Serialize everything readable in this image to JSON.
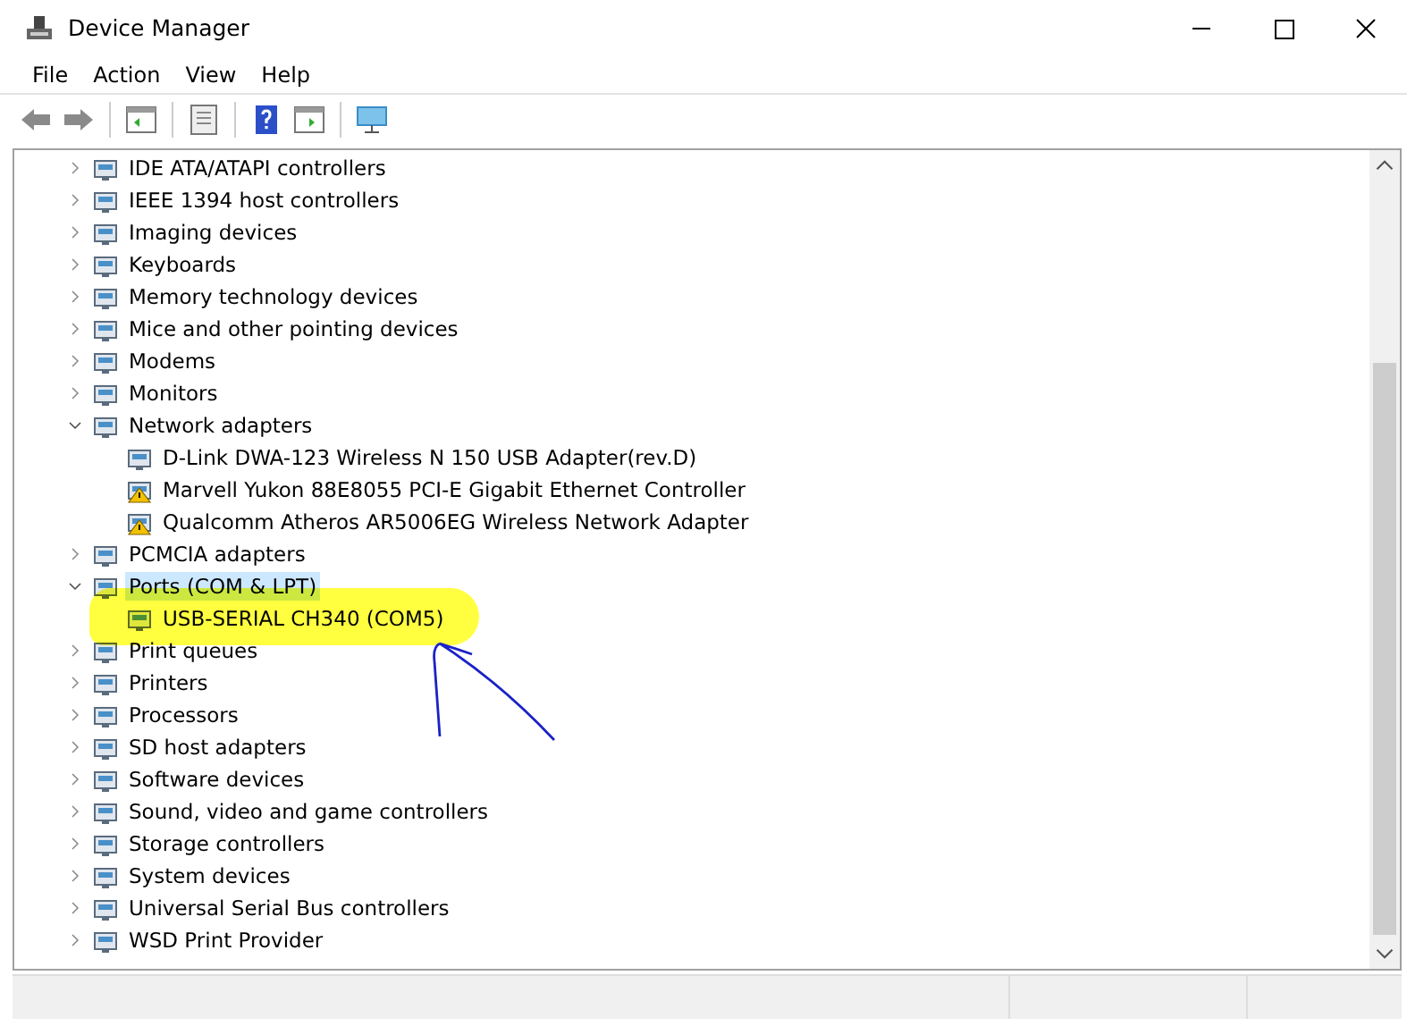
{
  "window": {
    "title": "Device Manager"
  },
  "menu": [
    "File",
    "Action",
    "View",
    "Help"
  ],
  "tree": [
    {
      "label": "IDE ATA/ATAPI controllers",
      "expanded": false,
      "selected": false
    },
    {
      "label": "IEEE 1394 host controllers",
      "expanded": false,
      "selected": false
    },
    {
      "label": "Imaging devices",
      "expanded": false,
      "selected": false
    },
    {
      "label": "Keyboards",
      "expanded": false,
      "selected": false
    },
    {
      "label": "Memory technology devices",
      "expanded": false,
      "selected": false
    },
    {
      "label": "Mice and other pointing devices",
      "expanded": false,
      "selected": false
    },
    {
      "label": "Modems",
      "expanded": false,
      "selected": false
    },
    {
      "label": "Monitors",
      "expanded": false,
      "selected": false
    },
    {
      "label": "Network adapters",
      "expanded": true,
      "selected": false,
      "children": [
        {
          "label": "D-Link DWA-123 Wireless N 150 USB Adapter(rev.D)",
          "warning": false,
          "selected": false
        },
        {
          "label": "Marvell Yukon 88E8055 PCI-E Gigabit Ethernet Controller",
          "warning": true,
          "selected": false
        },
        {
          "label": "Qualcomm Atheros AR5006EG Wireless Network Adapter",
          "warning": true,
          "selected": false
        }
      ]
    },
    {
      "label": "PCMCIA adapters",
      "expanded": false,
      "selected": false
    },
    {
      "label": "Ports (COM & LPT)",
      "expanded": true,
      "selected": true,
      "children": [
        {
          "label": "USB-SERIAL CH340 (COM5)",
          "warning": false,
          "selected": false
        }
      ]
    },
    {
      "label": "Print queues",
      "expanded": false,
      "selected": false
    },
    {
      "label": "Printers",
      "expanded": false,
      "selected": false
    },
    {
      "label": "Processors",
      "expanded": false,
      "selected": false
    },
    {
      "label": "SD host adapters",
      "expanded": false,
      "selected": false
    },
    {
      "label": "Software devices",
      "expanded": false,
      "selected": false
    },
    {
      "label": "Sound, video and game controllers",
      "expanded": false,
      "selected": false
    },
    {
      "label": "Storage controllers",
      "expanded": false,
      "selected": false
    },
    {
      "label": "System devices",
      "expanded": false,
      "selected": false
    },
    {
      "label": "Universal Serial Bus controllers",
      "expanded": false,
      "selected": false
    },
    {
      "label": "WSD Print Provider",
      "expanded": false,
      "selected": false
    }
  ]
}
